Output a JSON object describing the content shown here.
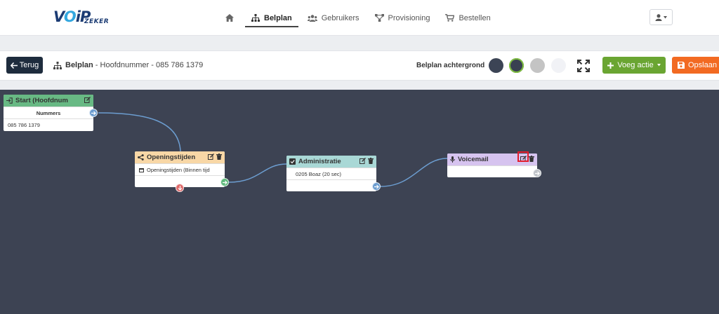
{
  "logo": {
    "part1": "V",
    "part2": "O",
    "part3": "iP",
    "sub": "ZEKER"
  },
  "nav": {
    "home_icon": "home-icon",
    "items": [
      {
        "label": "Belplan",
        "icon": "sitemap-icon",
        "active": true
      },
      {
        "label": "Gebruikers",
        "icon": "users-icon",
        "active": false
      },
      {
        "label": "Provisioning",
        "icon": "network-icon",
        "active": false
      },
      {
        "label": "Bestellen",
        "icon": "cart-icon",
        "active": false
      }
    ]
  },
  "toolbar": {
    "back_label": "Terug",
    "crumb_title": "Belplan",
    "crumb_rest": " - Hoofdnummer - 085 786 1379",
    "bg_label": "Belplan achtergrond",
    "swatches": [
      "#3c4455",
      "#394151",
      "#c4c4c4",
      "#f1f2f6"
    ],
    "add_label": "Voeg actie",
    "save_label": "Opslaan"
  },
  "colors": {
    "start": "#68b984",
    "openingstijden": "#f8d7a6",
    "administratie": "#a9d8d6",
    "voicemail": "#d6c3ef",
    "canvas": "#3d4353",
    "wire": "#6c9dd0"
  },
  "nodes": {
    "start": {
      "title": "Start (Hoofdnum",
      "section": "Nummers",
      "row": "085 786 1379"
    },
    "openingstijden": {
      "title": "Openingstijden",
      "row": "Openingstijden (Binnen tijd"
    },
    "administratie": {
      "title": "Administratie",
      "row": "0205 Boaz (20 sec)"
    },
    "voicemail": {
      "title": "Voicemail"
    }
  }
}
